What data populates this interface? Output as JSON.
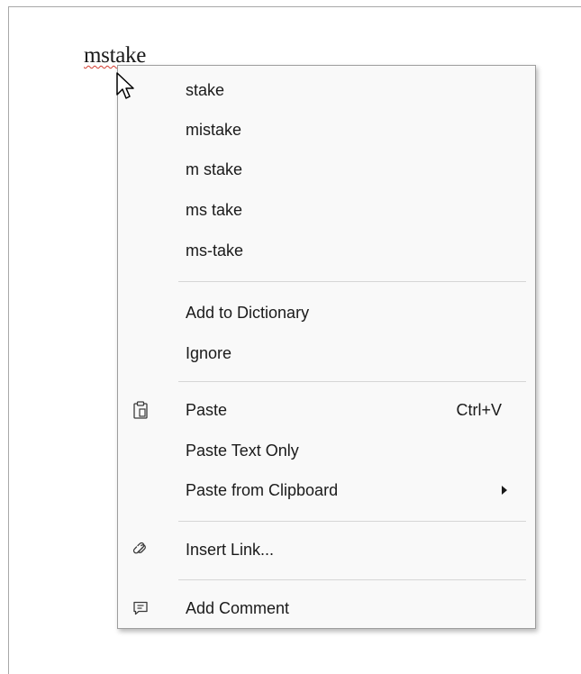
{
  "document": {
    "misspelled_word": "mstake"
  },
  "context_menu": {
    "suggestions": [
      "stake",
      "mistake",
      "m stake",
      "ms take",
      "ms-take"
    ],
    "add_to_dictionary": "Add to Dictionary",
    "ignore": "Ignore",
    "paste": {
      "label": "Paste",
      "shortcut": "Ctrl+V",
      "icon": "clipboard-icon"
    },
    "paste_text_only": "Paste Text Only",
    "paste_from_clipboard": {
      "label": "Paste from Clipboard",
      "icon": "submenu-arrow-icon"
    },
    "insert_link": {
      "label": "Insert Link...",
      "icon": "link-icon"
    },
    "add_comment": {
      "label": "Add Comment",
      "icon": "comment-icon"
    }
  },
  "colors": {
    "menu_background": "#f9f9f9",
    "menu_border": "#9d9d9d",
    "separator": "#d6d6d6",
    "spell_underline": "#d23b2f"
  }
}
